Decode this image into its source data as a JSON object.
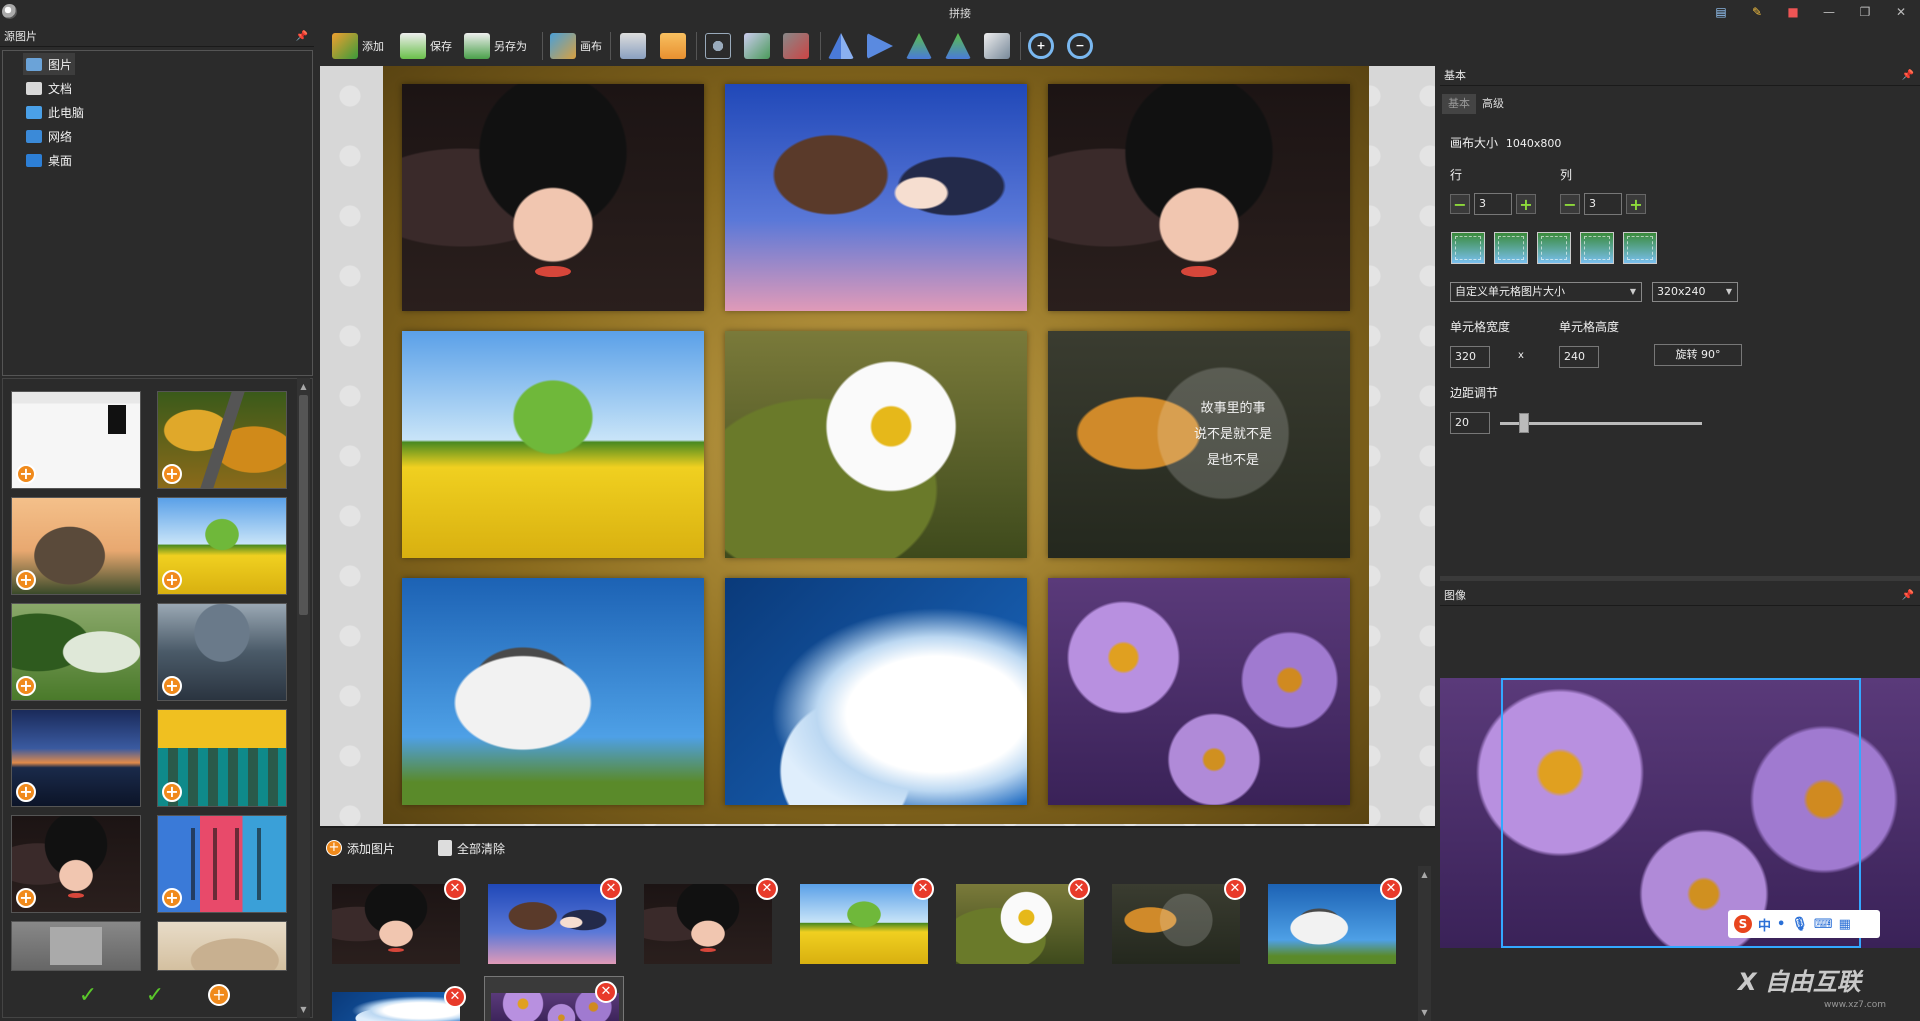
{
  "window": {
    "title": "拼接",
    "controls": [
      "—",
      "❐",
      "✕"
    ]
  },
  "left": {
    "header": "源图片",
    "tree": [
      {
        "label": "图片",
        "icon": "pictures-icon",
        "color": "#6ba3d8"
      },
      {
        "label": "文档",
        "icon": "documents-icon",
        "color": "#d9d9d9"
      },
      {
        "label": "此电脑",
        "icon": "computer-icon",
        "color": "#4aa0e8"
      },
      {
        "label": "网络",
        "icon": "network-icon",
        "color": "#3b8ad8"
      },
      {
        "label": "桌面",
        "icon": "desktop-icon",
        "color": "#2d7fd6"
      }
    ],
    "bottom_tools": [
      "✓",
      "✓",
      "+"
    ]
  },
  "toolbar": {
    "add": "添加",
    "save": "保存",
    "save_as": "另存为",
    "canvas": "画布"
  },
  "strip": {
    "add_button": "添加图片",
    "clear_button": "全部清除"
  },
  "right": {
    "header": "基本",
    "tabs": [
      "基本",
      "高级"
    ],
    "canvas_size_label": "画布大小",
    "canvas_size_value": "1040x800",
    "rows_label": "行",
    "rows_value": "3",
    "cols_label": "列",
    "cols_value": "3",
    "cell_mode": "自定义单元格图片大小",
    "cell_preset": "320x240",
    "cell_width_label": "单元格宽度",
    "cell_height_label": "单元格高度",
    "cell_width": "320",
    "times": "x",
    "cell_height": "240",
    "rotate_button": "旋转 90°",
    "margin_label": "边距调节",
    "margin_value": "20",
    "margin_slider_fraction": 0.09
  },
  "image_panel": {
    "header": "图像",
    "ime_text": "中"
  },
  "collage": {
    "cells": [
      "girl",
      "anime",
      "girl",
      "tree",
      "daisy",
      "leaf",
      "dog",
      "cloud",
      "purple"
    ],
    "leaf_text": [
      "故事里的事",
      "说不是就不是",
      "是也不是"
    ]
  },
  "watermark": {
    "text": "自由互联",
    "url": "www.xz7.com"
  }
}
